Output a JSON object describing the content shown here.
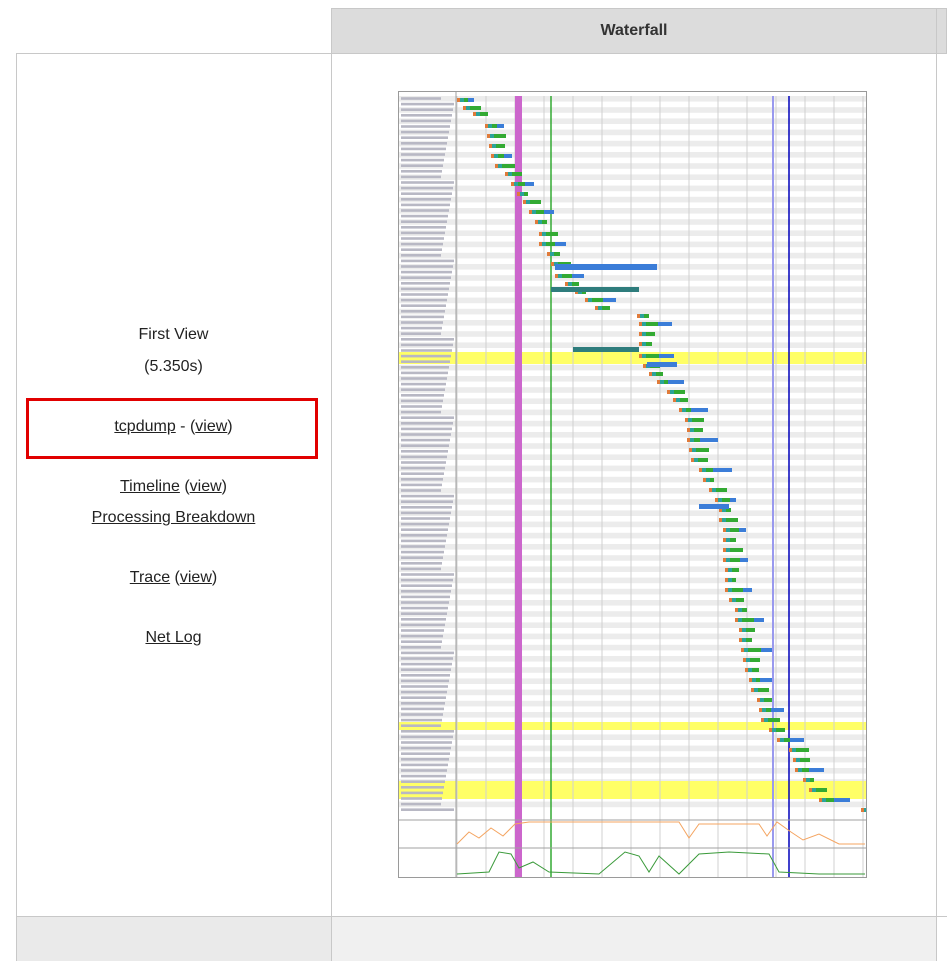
{
  "header": {
    "waterfall_label": "Waterfall"
  },
  "first_view": {
    "label": "First View",
    "time": "(5.350s)"
  },
  "links": {
    "tcpdump": "tcpdump",
    "tcpdump_sep": " - (",
    "tcpdump_view": "view",
    "tcpdump_close": ")",
    "timeline": "Timeline",
    "timeline_open": " (",
    "timeline_view": "view",
    "timeline_close": ")",
    "processing_breakdown": "Processing Breakdown",
    "trace": "Trace",
    "trace_open": " (",
    "trace_view": "view",
    "trace_close": ")",
    "net_log": "Net Log"
  },
  "colors": {
    "highlight_border": "#e10000",
    "header_bg": "#dcdcdc",
    "row_highlight": "#ffff66",
    "start_render": "#cc66cc",
    "dom_content": "#33aa33",
    "onload": "#9999ee",
    "fully_loaded": "#0000bb",
    "cpu_line": "#f4a460",
    "bandwidth_line": "#3a9a3a"
  }
}
